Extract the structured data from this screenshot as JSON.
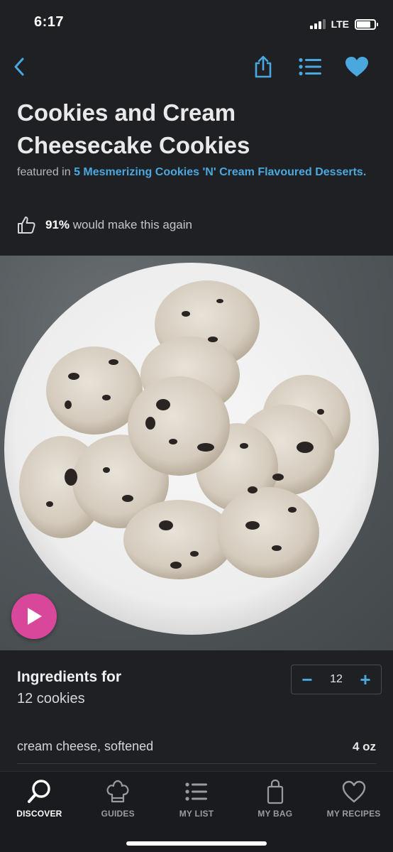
{
  "status_bar": {
    "time": "6:17",
    "network": "LTE"
  },
  "nav": {
    "icons": [
      "back-chevron-icon",
      "share-icon",
      "list-icon",
      "heart-icon"
    ]
  },
  "recipe": {
    "title": "Cookies and Cream Cheesecake Cookies",
    "featured_prefix": "featured in",
    "featured_link": "5 Mesmerizing Cookies 'N' Cream Flavoured Desserts.",
    "rating_percent": "91%",
    "rating_text": "would make this again"
  },
  "ingredients": {
    "title": "Ingredients for",
    "servings": "12 cookies",
    "stepper": {
      "minus": "−",
      "value": "12",
      "plus": "+"
    },
    "items": [
      {
        "name": "cream cheese, softened",
        "qty": "4 oz"
      }
    ]
  },
  "tabs": [
    {
      "label": "DISCOVER",
      "icon": "search-icon",
      "active": true
    },
    {
      "label": "GUIDES",
      "icon": "chef-hat-icon",
      "active": false
    },
    {
      "label": "MY LIST",
      "icon": "list-icon",
      "active": false
    },
    {
      "label": "MY BAG",
      "icon": "bag-icon",
      "active": false
    },
    {
      "label": "MY RECIPES",
      "icon": "heart-outline-icon",
      "active": false
    }
  ],
  "colors": {
    "accent": "#4aa8df",
    "play": "#d9479b",
    "background": "#1f2024"
  }
}
